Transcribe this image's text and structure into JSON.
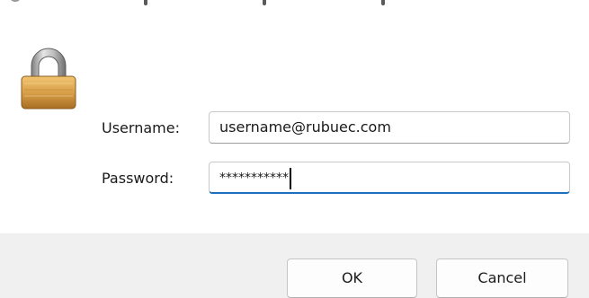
{
  "form": {
    "username_label": "Username:",
    "password_label": "Password:",
    "username_value": "username@rubuec.com",
    "password_value": "***********"
  },
  "buttons": {
    "ok_label": "OK",
    "cancel_label": "Cancel"
  },
  "icons": {
    "lock": "padlock-icon"
  },
  "colors": {
    "focus_accent": "#1f6fbf",
    "footer_bg": "#f0f0f0",
    "lock_gold": "#d9a04a"
  }
}
